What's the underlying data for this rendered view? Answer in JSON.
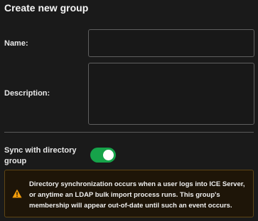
{
  "form": {
    "title": "Create new group",
    "name_label": "Name:",
    "name_value": "",
    "description_label": "Description:",
    "description_value": "",
    "sync_label": "Sync with directory group",
    "sync_enabled": true
  },
  "alert": {
    "icon": "warning-icon",
    "message": "Directory synchronization occurs when a user logs into ICE Server, or anytime an LDAP bulk import process runs. This group's membership will appear out-of-date until such an event occurs."
  },
  "colors": {
    "background": "#1a1a1a",
    "toggle_on": "#16a34a",
    "warning": "#f59e0b",
    "alert_background": "#1e1508",
    "alert_border": "#5e4514"
  }
}
